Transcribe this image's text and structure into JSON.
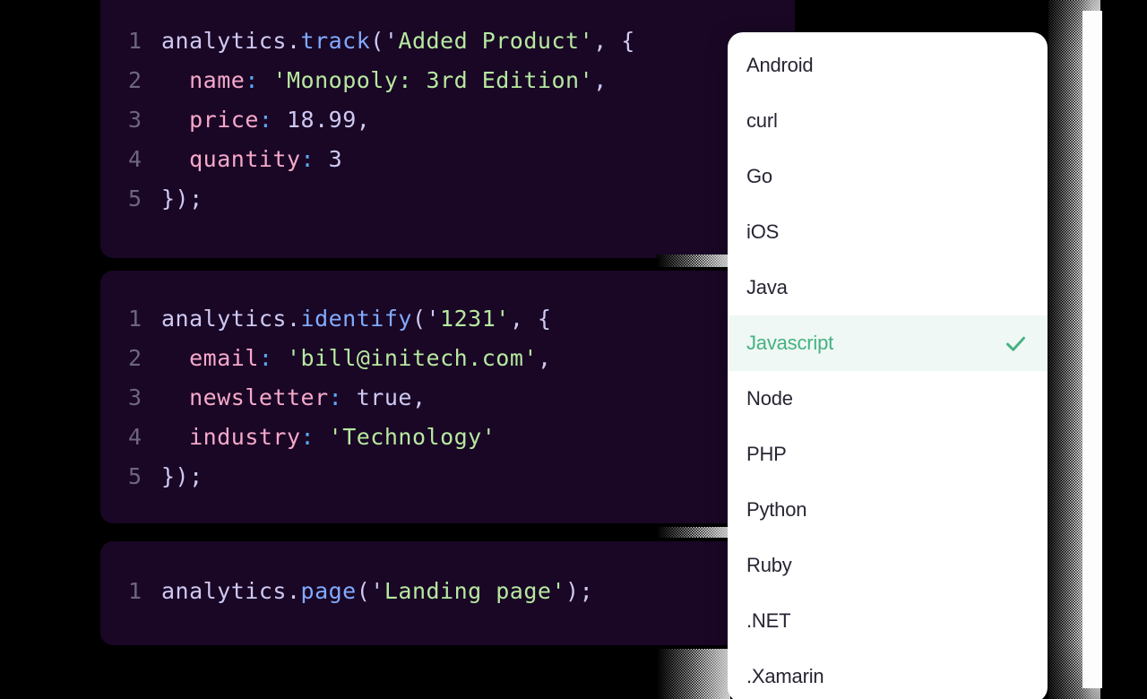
{
  "theme": {
    "page_background": "#000000",
    "code_background": "#190725",
    "dropdown_background": "#ffffff",
    "selected_row_background": "#eff8f4",
    "accent_green": "#45b183",
    "gutter_color": "#6e6580",
    "token_default": "#cfc9f2",
    "token_function": "#82aaff",
    "token_string": "#b7e8a0",
    "token_property": "#f7a8cb",
    "token_colon": "#5fa8f5"
  },
  "code_blocks": [
    {
      "id": "track-snippet",
      "language": "Javascript",
      "lines": [
        {
          "number": "1",
          "tokens": [
            {
              "t": "analytics.",
              "c": "t-plain"
            },
            {
              "t": "track",
              "c": "t-fn"
            },
            {
              "t": "('",
              "c": "t-punct"
            },
            {
              "t": "Added Product",
              "c": "t-str"
            },
            {
              "t": "'",
              "c": "t-str"
            },
            {
              "t": ", {",
              "c": "t-punct"
            }
          ]
        },
        {
          "number": "2",
          "tokens": [
            {
              "t": "  ",
              "c": "t-plain"
            },
            {
              "t": "name",
              "c": "t-prop"
            },
            {
              "t": ":",
              "c": "t-colon"
            },
            {
              "t": " ",
              "c": "t-plain"
            },
            {
              "t": "'Monopoly: 3rd Edition'",
              "c": "t-str"
            },
            {
              "t": ",",
              "c": "t-punct"
            }
          ]
        },
        {
          "number": "3",
          "tokens": [
            {
              "t": "  ",
              "c": "t-plain"
            },
            {
              "t": "price",
              "c": "t-prop"
            },
            {
              "t": ":",
              "c": "t-colon"
            },
            {
              "t": " ",
              "c": "t-plain"
            },
            {
              "t": "18.99",
              "c": "t-num"
            },
            {
              "t": ",",
              "c": "t-punct"
            }
          ]
        },
        {
          "number": "4",
          "tokens": [
            {
              "t": "  ",
              "c": "t-plain"
            },
            {
              "t": "quantity",
              "c": "t-prop"
            },
            {
              "t": ":",
              "c": "t-colon"
            },
            {
              "t": " ",
              "c": "t-plain"
            },
            {
              "t": "3",
              "c": "t-num"
            }
          ]
        },
        {
          "number": "5",
          "tokens": [
            {
              "t": "});",
              "c": "t-punct"
            }
          ]
        }
      ]
    },
    {
      "id": "identify-snippet",
      "language": "Javascript",
      "lines": [
        {
          "number": "1",
          "tokens": [
            {
              "t": "analytics.",
              "c": "t-plain"
            },
            {
              "t": "identify",
              "c": "t-fn"
            },
            {
              "t": "('",
              "c": "t-punct"
            },
            {
              "t": "1231",
              "c": "t-str"
            },
            {
              "t": "'",
              "c": "t-str"
            },
            {
              "t": ", {",
              "c": "t-punct"
            }
          ]
        },
        {
          "number": "2",
          "tokens": [
            {
              "t": "  ",
              "c": "t-plain"
            },
            {
              "t": "email",
              "c": "t-prop"
            },
            {
              "t": ":",
              "c": "t-colon"
            },
            {
              "t": " ",
              "c": "t-plain"
            },
            {
              "t": "'bill@initech.com'",
              "c": "t-str"
            },
            {
              "t": ",",
              "c": "t-punct"
            }
          ]
        },
        {
          "number": "3",
          "tokens": [
            {
              "t": "  ",
              "c": "t-plain"
            },
            {
              "t": "newsletter",
              "c": "t-prop"
            },
            {
              "t": ":",
              "c": "t-colon"
            },
            {
              "t": " ",
              "c": "t-plain"
            },
            {
              "t": "true",
              "c": "t-num"
            },
            {
              "t": ",",
              "c": "t-punct"
            }
          ]
        },
        {
          "number": "4",
          "tokens": [
            {
              "t": "  ",
              "c": "t-plain"
            },
            {
              "t": "industry",
              "c": "t-prop"
            },
            {
              "t": ":",
              "c": "t-colon"
            },
            {
              "t": " ",
              "c": "t-plain"
            },
            {
              "t": "'Technology'",
              "c": "t-str"
            }
          ]
        },
        {
          "number": "5",
          "tokens": [
            {
              "t": "});",
              "c": "t-punct"
            }
          ]
        }
      ]
    },
    {
      "id": "page-snippet",
      "language": "Javascript",
      "lines": [
        {
          "number": "1",
          "tokens": [
            {
              "t": "analytics.",
              "c": "t-plain"
            },
            {
              "t": "page",
              "c": "t-fn"
            },
            {
              "t": "('",
              "c": "t-punct"
            },
            {
              "t": "Landing page",
              "c": "t-str"
            },
            {
              "t": "'",
              "c": "t-str"
            },
            {
              "t": ");",
              "c": "t-punct"
            }
          ]
        }
      ]
    }
  ],
  "language_dropdown": {
    "selected": "Javascript",
    "check_icon": "check-icon",
    "items": [
      {
        "label": "Android",
        "selected": false
      },
      {
        "label": "curl",
        "selected": false
      },
      {
        "label": "Go",
        "selected": false
      },
      {
        "label": "iOS",
        "selected": false
      },
      {
        "label": "Java",
        "selected": false
      },
      {
        "label": "Javascript",
        "selected": true
      },
      {
        "label": "Node",
        "selected": false
      },
      {
        "label": "PHP",
        "selected": false
      },
      {
        "label": "Python",
        "selected": false
      },
      {
        "label": "Ruby",
        "selected": false
      },
      {
        "label": ".NET",
        "selected": false
      },
      {
        "label": ".Xamarin",
        "selected": false
      }
    ]
  }
}
